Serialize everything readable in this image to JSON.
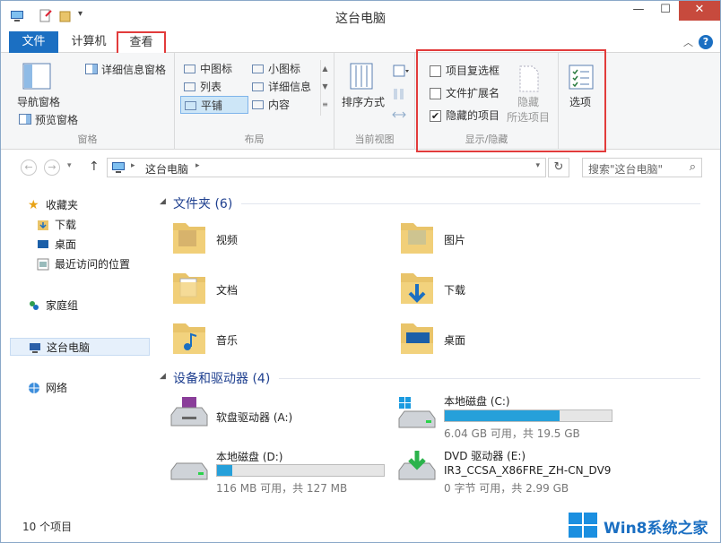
{
  "title_bar": {
    "title": "这台电脑",
    "minimize": "—",
    "maximize": "☐",
    "close": "✕"
  },
  "tabs": {
    "file": "文件",
    "computer": "计算机",
    "view": "查看",
    "help": "?"
  },
  "ribbon": {
    "panes": {
      "nav_pane": "导航窗格",
      "preview_pane": "预览窗格",
      "details_pane": "详细信息窗格",
      "label": "窗格"
    },
    "layout": {
      "items": [
        "中图标",
        "小图标",
        "列表",
        "详细信息",
        "平铺",
        "内容"
      ],
      "label": "布局"
    },
    "current_view": {
      "sort": "排序方式",
      "label": "当前视图"
    },
    "show_hide": {
      "item_checkboxes": "项目复选框",
      "file_extensions": "文件扩展名",
      "hidden_items": "隐藏的项目",
      "hide_selected_1": "隐藏",
      "hide_selected_2": "所选项目",
      "label": "显示/隐藏",
      "item_checkboxes_checked": false,
      "file_extensions_checked": false,
      "hidden_items_checked": true
    },
    "options": "选项"
  },
  "address": {
    "path": "这台电脑",
    "search_placeholder": "搜索\"这台电脑\""
  },
  "nav": {
    "favorites": "收藏夹",
    "downloads": "下载",
    "desktop": "桌面",
    "recent": "最近访问的位置",
    "homegroup": "家庭组",
    "this_pc": "这台电脑",
    "network": "网络"
  },
  "folders": {
    "header": "文件夹 (6)",
    "items": [
      "视频",
      "图片",
      "文档",
      "下载",
      "音乐",
      "桌面"
    ]
  },
  "devices": {
    "header": "设备和驱动器 (4)",
    "floppy": {
      "name": "软盘驱动器 (A:)"
    },
    "c": {
      "name": "本地磁盘 (C:)",
      "free": "6.04 GB 可用，共 19.5 GB",
      "used_fraction": 0.69
    },
    "d": {
      "name": "本地磁盘 (D:)",
      "free": "116 MB 可用，共 127 MB",
      "used_fraction": 0.09
    },
    "e": {
      "name": "DVD 驱动器 (E:)",
      "label": "IR3_CCSA_X86FRE_ZH-CN_DV9",
      "free": "0 字节 可用，共 2.99 GB"
    }
  },
  "status": {
    "count": "10 个项目"
  },
  "watermark": {
    "text": "Win8系统之家"
  }
}
